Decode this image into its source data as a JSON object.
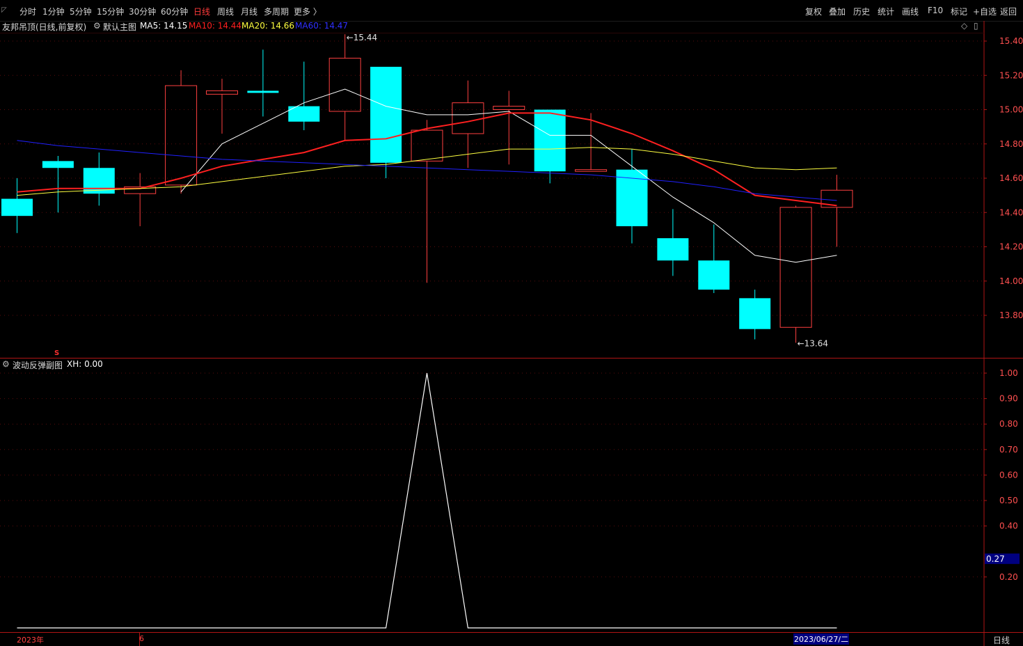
{
  "toolbar": {
    "periods": [
      "分时",
      "1分钟",
      "5分钟",
      "15分钟",
      "30分钟",
      "60分钟",
      "日线",
      "周线",
      "月线",
      "多周期",
      "更多 〉"
    ],
    "active_period": "日线",
    "right_buttons": [
      "复权",
      "叠加",
      "历史",
      "统计",
      "画线",
      "F10",
      "标记",
      "+自选",
      "返回"
    ]
  },
  "main_header": {
    "title": "友邦吊顶(日线,前复权)",
    "indicator": "默认主图",
    "ma5": "MA5: 14.15",
    "ma10": "MA10: 14.44",
    "ma20": "MA20: 14.66",
    "ma60": "MA60: 14.47"
  },
  "sub_header": {
    "title": "波动反弹副图",
    "xh": "XH: 0.00"
  },
  "bottom": {
    "year_label": "2023年",
    "month_label": "6",
    "cursor_date": "2023/06/27/二",
    "period_label": "日线",
    "marker": "S"
  },
  "colors": {
    "up": "#ff4040",
    "down": "#00ffff",
    "ma5": "#ffffff",
    "ma10": "#ff2020",
    "ma20": "#ffff40",
    "ma60": "#2020ff",
    "axis": "#b01414",
    "grid": "#5a0c0c",
    "label": "#ff5050"
  },
  "chart_data": [
    {
      "type": "candlestick",
      "title": "友邦吊顶(日线,前复权)",
      "y_ticks": [
        "15.40",
        "15.20",
        "15.00",
        "14.80",
        "14.60",
        "14.40",
        "14.20",
        "14.00",
        "13.80"
      ],
      "ylim": [
        13.57,
        15.46
      ],
      "candles": [
        {
          "o": 14.48,
          "h": 14.6,
          "l": 14.28,
          "c": 14.38
        },
        {
          "o": 14.7,
          "h": 14.73,
          "l": 14.4,
          "c": 14.66
        },
        {
          "o": 14.66,
          "h": 14.75,
          "l": 14.44,
          "c": 14.51
        },
        {
          "o": 14.51,
          "h": 14.63,
          "l": 14.32,
          "c": 14.55
        },
        {
          "o": 14.56,
          "h": 15.23,
          "l": 14.51,
          "c": 15.14
        },
        {
          "o": 15.09,
          "h": 15.18,
          "l": 14.86,
          "c": 15.11
        },
        {
          "o": 15.11,
          "h": 15.35,
          "l": 14.96,
          "c": 15.1
        },
        {
          "o": 15.02,
          "h": 15.28,
          "l": 14.88,
          "c": 14.93
        },
        {
          "o": 14.99,
          "h": 15.44,
          "l": 14.82,
          "c": 15.3
        },
        {
          "o": 15.25,
          "h": 15.25,
          "l": 14.6,
          "c": 14.69
        },
        {
          "o": 14.7,
          "h": 14.94,
          "l": 13.99,
          "c": 14.88
        },
        {
          "o": 14.86,
          "h": 15.17,
          "l": 14.66,
          "c": 15.04
        },
        {
          "o": 15.0,
          "h": 15.11,
          "l": 14.68,
          "c": 15.02
        },
        {
          "o": 15.0,
          "h": 15.0,
          "l": 14.57,
          "c": 14.64
        },
        {
          "o": 14.64,
          "h": 14.98,
          "l": 14.64,
          "c": 14.65
        },
        {
          "o": 14.65,
          "h": 14.77,
          "l": 14.22,
          "c": 14.32
        },
        {
          "o": 14.25,
          "h": 14.42,
          "l": 14.03,
          "c": 14.12
        },
        {
          "o": 14.12,
          "h": 14.33,
          "l": 13.93,
          "c": 13.95
        },
        {
          "o": 13.9,
          "h": 13.95,
          "l": 13.66,
          "c": 13.72
        },
        {
          "o": 13.73,
          "h": 14.44,
          "l": 13.64,
          "c": 14.43
        },
        {
          "o": 14.43,
          "h": 14.62,
          "l": 14.2,
          "c": 14.53
        }
      ],
      "ma_series": [
        {
          "name": "MA5",
          "values": [
            null,
            null,
            null,
            null,
            14.52,
            14.8,
            14.92,
            15.04,
            15.12,
            15.02,
            14.97,
            14.97,
            14.99,
            14.85,
            14.85,
            14.67,
            14.49,
            14.34,
            14.15,
            14.11,
            14.15
          ]
        },
        {
          "name": "MA10",
          "values": [
            14.52,
            14.54,
            14.54,
            14.54,
            14.6,
            14.67,
            14.71,
            14.75,
            14.82,
            14.83,
            14.89,
            14.93,
            14.98,
            14.98,
            14.94,
            14.86,
            14.76,
            14.65,
            14.5,
            14.47,
            14.44
          ]
        },
        {
          "name": "MA20",
          "values": [
            14.5,
            14.52,
            14.53,
            14.54,
            14.55,
            14.58,
            14.61,
            14.64,
            14.67,
            14.68,
            14.71,
            14.74,
            14.77,
            14.77,
            14.78,
            14.77,
            14.74,
            14.7,
            14.66,
            14.65,
            14.66
          ]
        },
        {
          "name": "MA60",
          "values": [
            14.82,
            14.79,
            14.77,
            14.75,
            14.73,
            14.71,
            14.7,
            14.69,
            14.68,
            14.67,
            14.66,
            14.65,
            14.64,
            14.63,
            14.62,
            14.6,
            14.58,
            14.55,
            14.51,
            14.49,
            14.47
          ]
        }
      ],
      "annotations": [
        {
          "text": "15.44",
          "index": 8,
          "value": 15.44
        },
        {
          "text": "13.64",
          "index": 19,
          "value": 13.64
        }
      ]
    },
    {
      "type": "line",
      "title": "波动反弹副图",
      "y_ticks": [
        "1.00",
        "0.90",
        "0.80",
        "0.70",
        "0.60",
        "0.50",
        "0.40",
        "0.20"
      ],
      "cursor_value": "0.27",
      "ylim": [
        0.0,
        1.0
      ],
      "series": [
        {
          "name": "XH",
          "values": [
            0,
            0,
            0,
            0,
            0,
            0,
            0,
            0,
            0,
            0,
            1,
            0,
            0,
            0,
            0,
            0,
            0,
            0,
            0,
            0,
            0
          ]
        }
      ]
    }
  ]
}
